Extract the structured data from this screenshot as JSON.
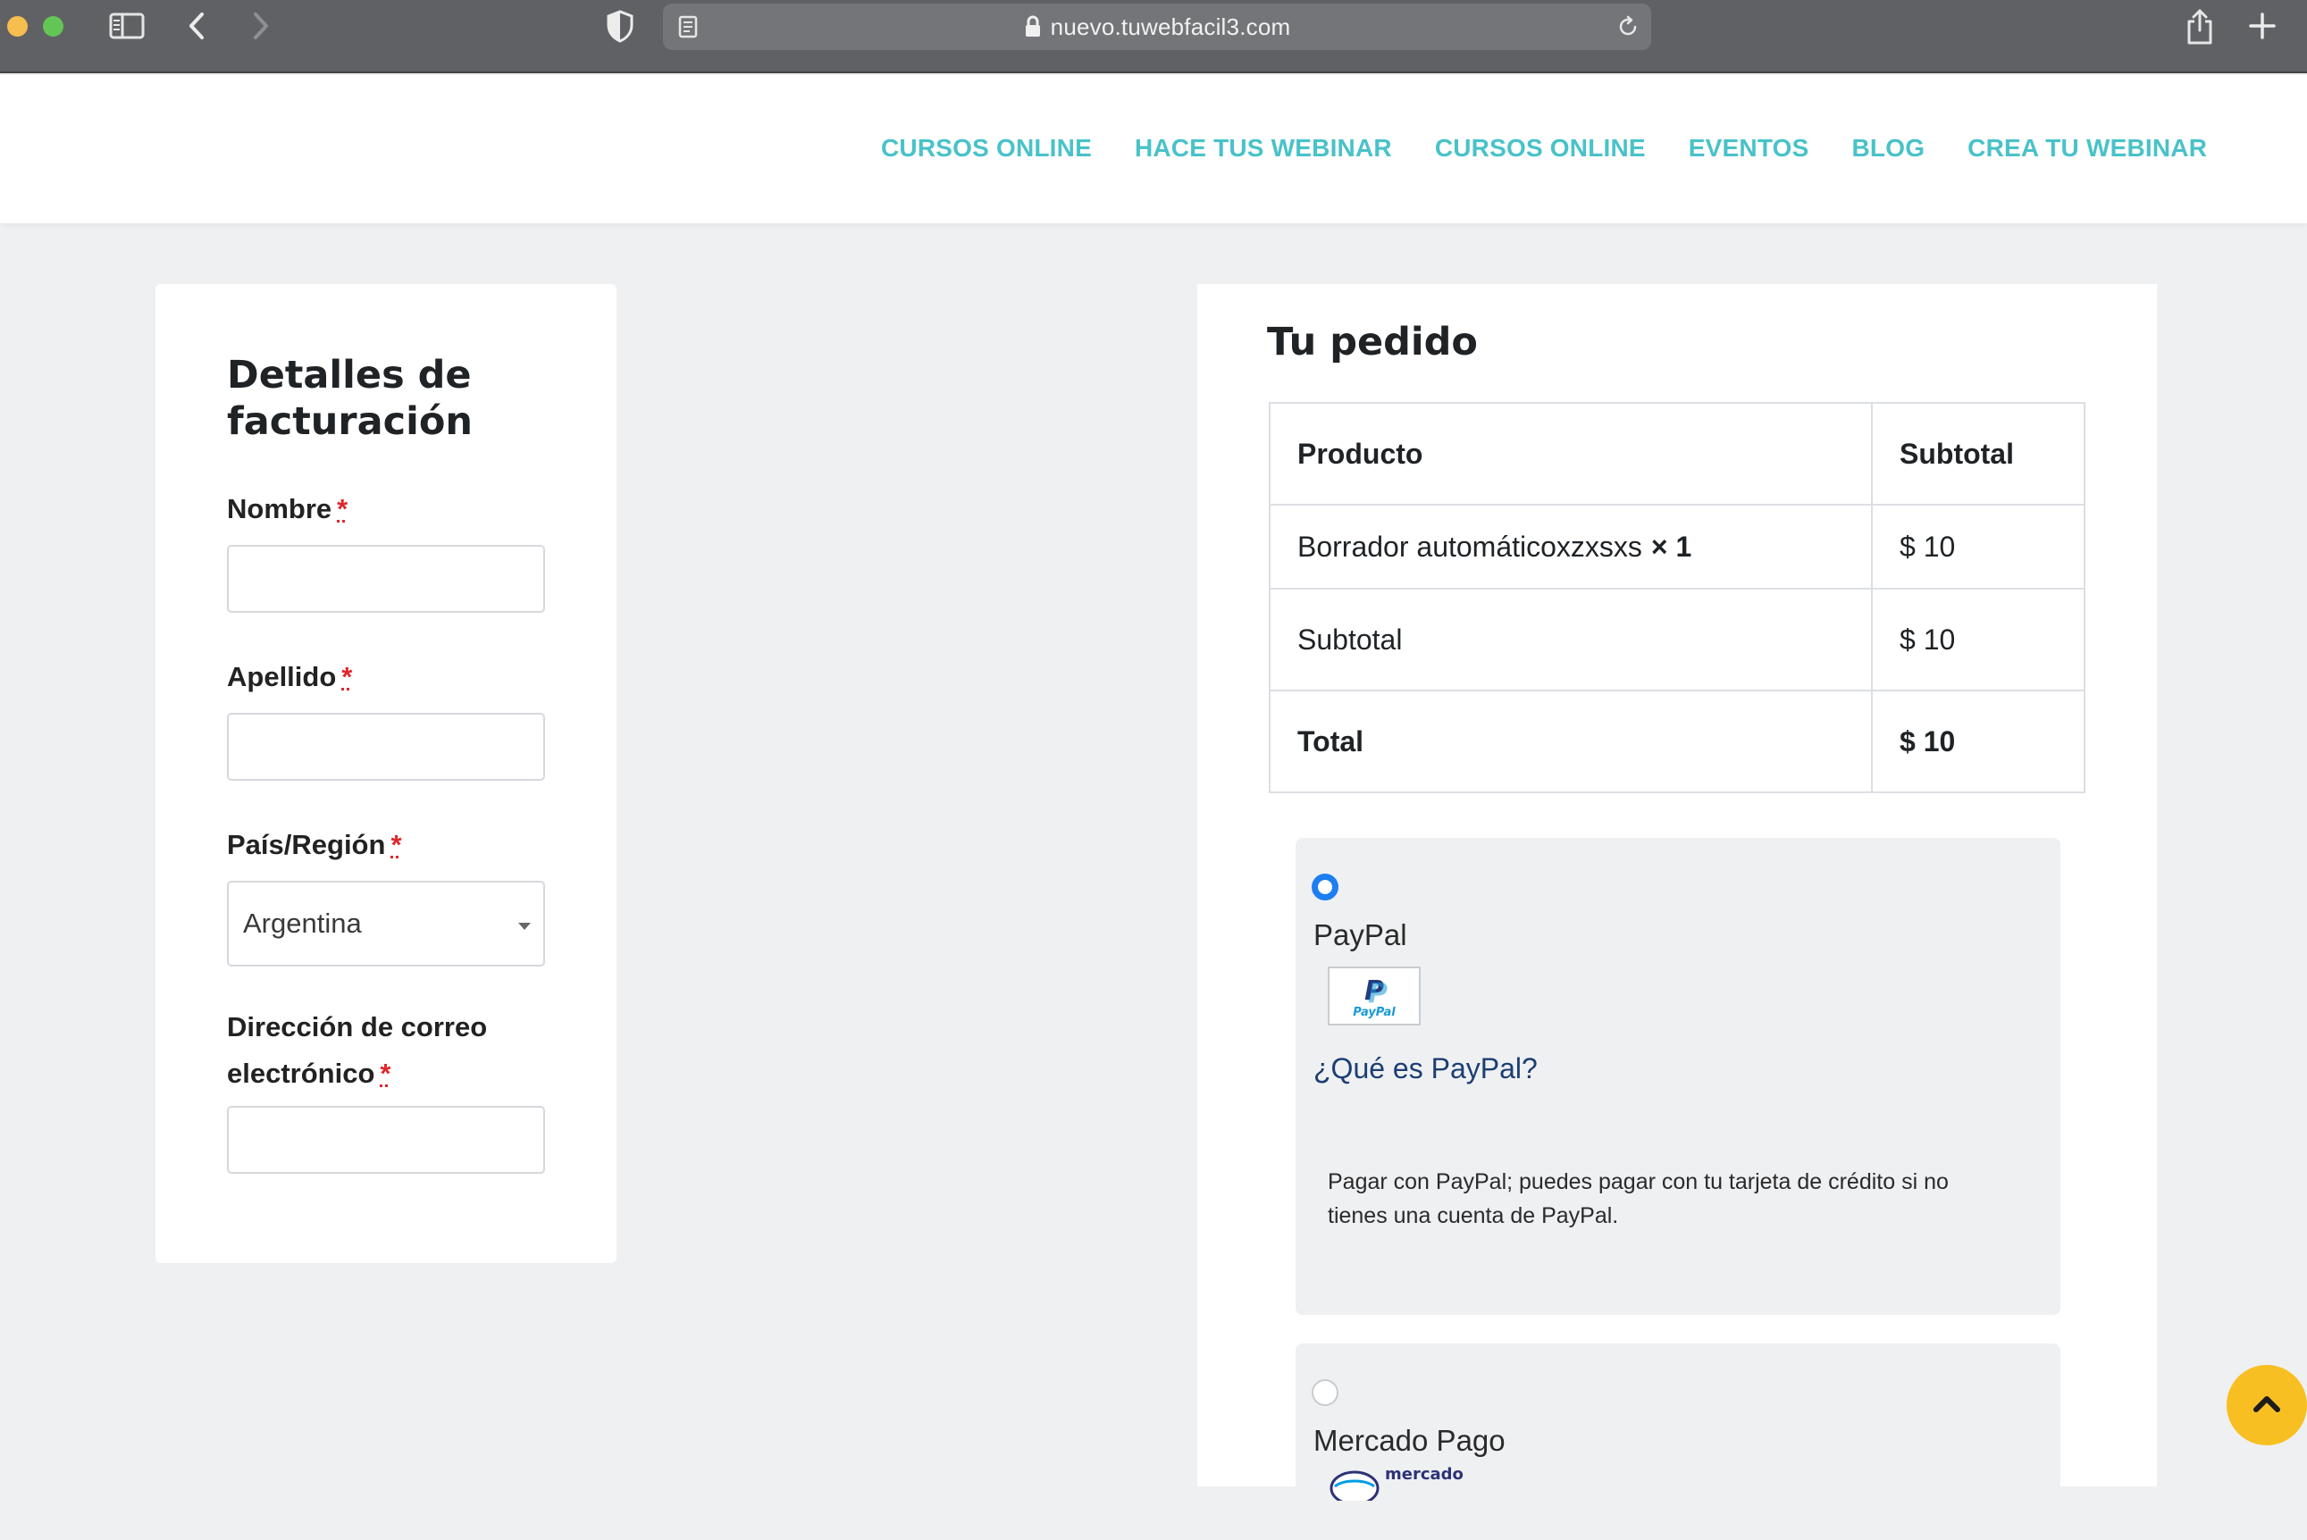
{
  "browser": {
    "url": "nuevo.tuwebfacil3.com",
    "icons": [
      "sidebar-icon",
      "back-icon",
      "forward-icon",
      "shield-icon",
      "reader-icon",
      "lock-icon",
      "reload-icon",
      "share-icon",
      "new-tab-icon"
    ]
  },
  "nav": {
    "items": [
      "CURSOS ONLINE",
      "HACE TUS WEBINAR",
      "CURSOS ONLINE",
      "EVENTOS",
      "BLOG",
      "CREA TU WEBINAR"
    ],
    "color": "#49c2c9"
  },
  "billing": {
    "title": "Detalles de facturación",
    "required_mark": "*",
    "fields": {
      "first_name": {
        "label": "Nombre",
        "value": ""
      },
      "last_name": {
        "label": "Apellido",
        "value": ""
      },
      "country": {
        "label": "País/Región",
        "value": "Argentina"
      },
      "email": {
        "label": "Dirección de correo electrónico",
        "value": ""
      }
    }
  },
  "order": {
    "title": "Tu pedido",
    "headers": {
      "product": "Producto",
      "subtotal": "Subtotal"
    },
    "item": {
      "name": "Borrador automáticoxzxsxs",
      "qty": "× 1",
      "price": "$ 10"
    },
    "subtotal": {
      "label": "Subtotal",
      "value": "$ 10"
    },
    "total": {
      "label": "Total",
      "value": "$ 10"
    }
  },
  "payment": {
    "paypal": {
      "name": "PayPal",
      "selected": true,
      "logo_text": "PayPal",
      "link": "¿Qué es PayPal?",
      "description": "Pagar con PayPal; puedes pagar con tu tarjeta de crédito si no tienes una cuenta de PayPal."
    },
    "mercadopago": {
      "name": "Mercado Pago",
      "selected": false,
      "logo_text": "mercado"
    },
    "radio_color": "#1d7ef2"
  },
  "scroll_top_color": "#f8bf22"
}
